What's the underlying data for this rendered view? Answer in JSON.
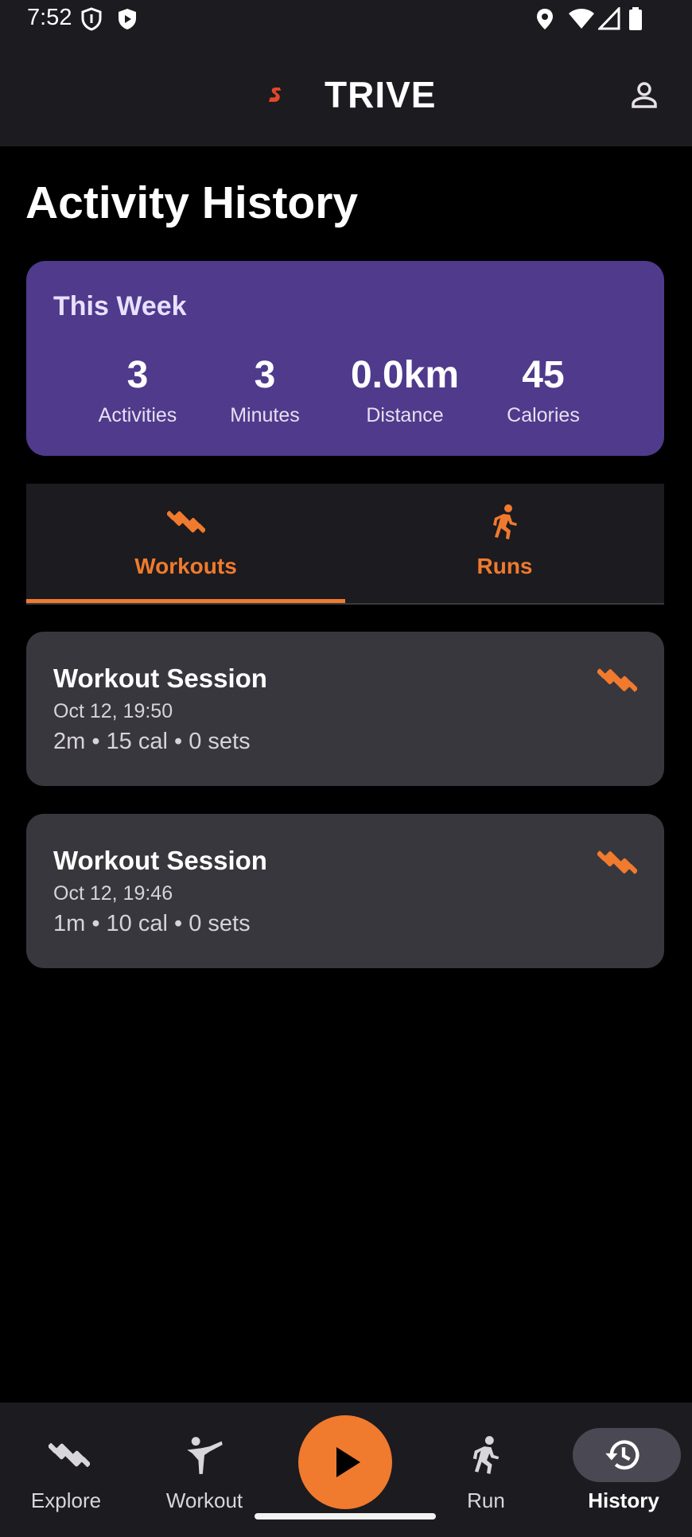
{
  "status_bar": {
    "time": "7:52",
    "left_icons": [
      "shield-outline-icon",
      "shield-play-icon"
    ],
    "right_icons": [
      "location-icon",
      "wifi-icon",
      "signal-icon",
      "battery-icon"
    ]
  },
  "header": {
    "logo_letter": "S",
    "logo_text": "TRIVE",
    "profile_icon": "person-icon"
  },
  "page": {
    "title": "Activity History"
  },
  "this_week": {
    "title": "This Week",
    "stats": [
      {
        "value": "3",
        "label": "Activities"
      },
      {
        "value": "3",
        "label": "Minutes"
      },
      {
        "value": "0.0km",
        "label": "Distance"
      },
      {
        "value": "45",
        "label": "Calories"
      }
    ]
  },
  "tabs": [
    {
      "label": "Workouts",
      "icon": "dumbbell-icon",
      "selected": true
    },
    {
      "label": "Runs",
      "icon": "runner-icon",
      "selected": false
    }
  ],
  "sessions": [
    {
      "title": "Workout Session",
      "date": "Oct 12, 19:50",
      "meta": "2m • 15 cal • 0 sets",
      "icon": "dumbbell-icon"
    },
    {
      "title": "Workout Session",
      "date": "Oct 12, 19:46",
      "meta": "1m • 10 cal • 0 sets",
      "icon": "dumbbell-icon"
    }
  ],
  "bottom_nav": {
    "items": [
      {
        "label": "Explore",
        "icon": "dumbbell-icon"
      },
      {
        "label": "Workout",
        "icon": "martial-arts-icon"
      },
      {
        "label": "Run",
        "icon": "runner-icon"
      },
      {
        "label": "History",
        "icon": "history-icon",
        "active": true
      }
    ],
    "play_icon": "play-icon"
  },
  "colors": {
    "accent": "#f07a2e",
    "logo_red": "#e0482a",
    "card_purple": "#4f3a8c",
    "card_gray": "#38373d",
    "surface": "#1c1b1f"
  }
}
